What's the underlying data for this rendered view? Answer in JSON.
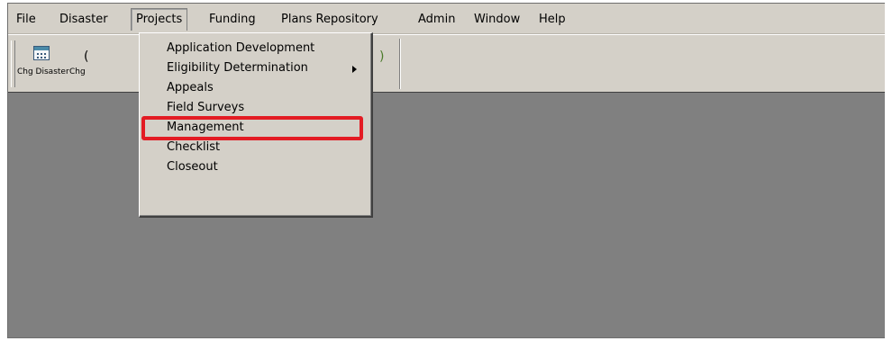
{
  "menubar": {
    "items": [
      {
        "label": "File"
      },
      {
        "label": "Disaster"
      },
      {
        "label": "Projects"
      },
      {
        "label": "Funding"
      },
      {
        "label": "Plans Repository"
      },
      {
        "label": "Admin"
      },
      {
        "label": "Window"
      },
      {
        "label": "Help"
      }
    ],
    "open_menu": "Projects"
  },
  "toolbar": {
    "buttons": [
      {
        "label": "Chg Disaster",
        "icon": "calendar-icon"
      },
      {
        "label": "Chg",
        "icon": "partial-icon"
      }
    ]
  },
  "dropdown": {
    "items": [
      {
        "label": "Application Development",
        "has_submenu": false
      },
      {
        "label": "Eligibility Determination",
        "has_submenu": true
      },
      {
        "label": "Appeals",
        "has_submenu": false
      },
      {
        "label": "Field Surveys",
        "has_submenu": false
      },
      {
        "label": "Management",
        "has_submenu": false,
        "highlighted": true
      },
      {
        "label": "Checklist",
        "has_submenu": false
      },
      {
        "label": "Closeout",
        "has_submenu": false
      }
    ],
    "highlight_color": "#e31b23"
  },
  "colors": {
    "workspace": "#808080",
    "chrome": "#d4d0c8"
  }
}
